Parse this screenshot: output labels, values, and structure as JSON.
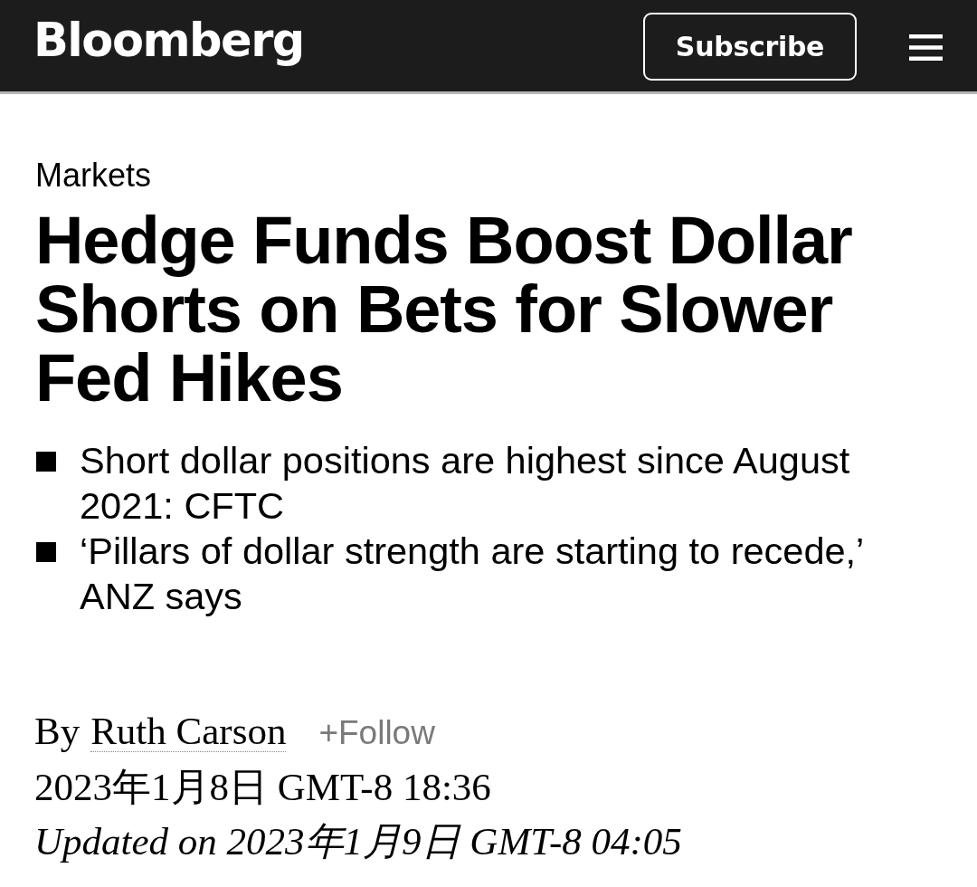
{
  "header": {
    "logo": "Bloomberg",
    "subscribe_button": "Subscribe"
  },
  "article": {
    "category": "Markets",
    "headline": "Hedge Funds Boost Dollar Shorts on Bets for Slower Fed Hikes",
    "bullets": [
      "Short dollar positions are highest since August 2021: CFTC",
      "‘Pillars of dollar strength are starting to recede,’ ANZ says"
    ]
  },
  "byline": {
    "prefix": "By",
    "author": "Ruth Carson",
    "follow": "+Follow",
    "published": "2023年1月8日 GMT-8 18:36",
    "updated": "Updated on 2023年1月9日 GMT-8 04:05"
  }
}
